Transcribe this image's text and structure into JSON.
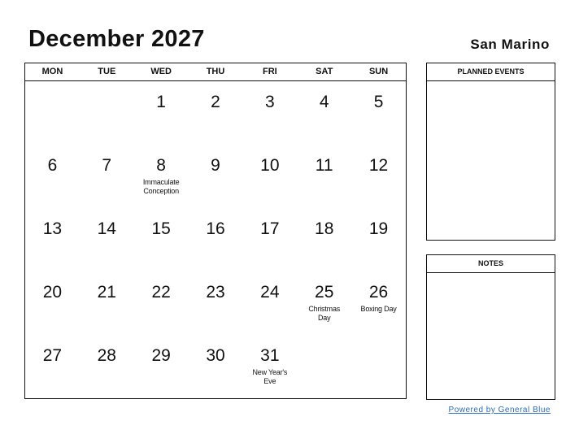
{
  "header": {
    "title": "December 2027",
    "country": "San Marino"
  },
  "calendar": {
    "weekdays": [
      "MON",
      "TUE",
      "WED",
      "THU",
      "FRI",
      "SAT",
      "SUN"
    ],
    "weeks": [
      [
        {
          "d": ""
        },
        {
          "d": ""
        },
        {
          "d": "1"
        },
        {
          "d": "2"
        },
        {
          "d": "3"
        },
        {
          "d": "4"
        },
        {
          "d": "5"
        }
      ],
      [
        {
          "d": "6"
        },
        {
          "d": "7"
        },
        {
          "d": "8",
          "e": "Immaculate Conception"
        },
        {
          "d": "9"
        },
        {
          "d": "10"
        },
        {
          "d": "11"
        },
        {
          "d": "12"
        }
      ],
      [
        {
          "d": "13"
        },
        {
          "d": "14"
        },
        {
          "d": "15"
        },
        {
          "d": "16"
        },
        {
          "d": "17"
        },
        {
          "d": "18"
        },
        {
          "d": "19"
        }
      ],
      [
        {
          "d": "20"
        },
        {
          "d": "21"
        },
        {
          "d": "22"
        },
        {
          "d": "23"
        },
        {
          "d": "24"
        },
        {
          "d": "25",
          "e": "Christmas Day"
        },
        {
          "d": "26",
          "e": "Boxing Day"
        }
      ],
      [
        {
          "d": "27"
        },
        {
          "d": "28"
        },
        {
          "d": "29"
        },
        {
          "d": "30"
        },
        {
          "d": "31",
          "e": "New Year's Eve"
        },
        {
          "d": ""
        },
        {
          "d": ""
        }
      ]
    ]
  },
  "planned_events": {
    "label": "PLANNED EVENTS"
  },
  "notes": {
    "label": "NOTES"
  },
  "footer": {
    "link_text": "Powered by General Blue",
    "link_color": "#2a6db8"
  }
}
